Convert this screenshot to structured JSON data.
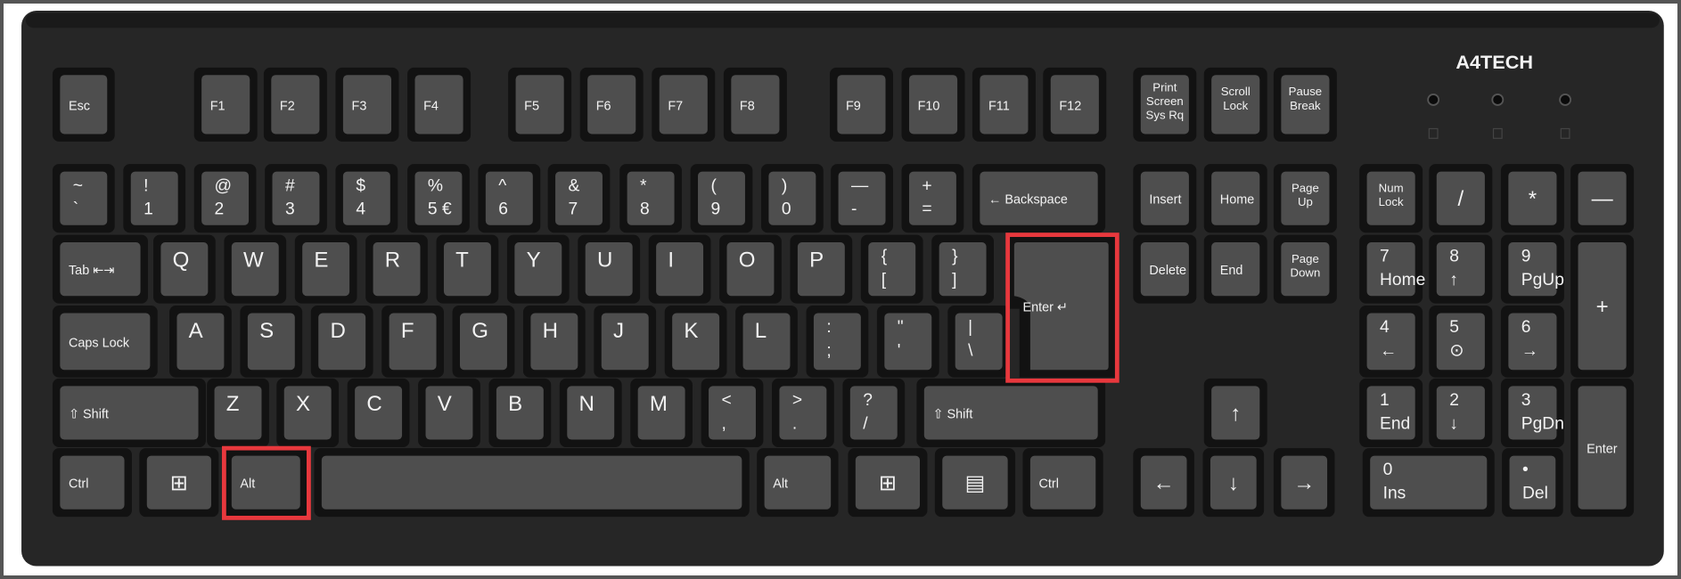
{
  "brand": {
    "logo": "A4TECH"
  },
  "colors": {
    "body": "#262626",
    "well": "#121212",
    "cap": "#4e4e4e",
    "legend": "#f2f2f2",
    "highlight": "#e8383d"
  },
  "indicators": [
    "num-lock-led",
    "caps-lock-led",
    "scroll-lock-led"
  ],
  "highlighted_keys": [
    "enter",
    "alt-left"
  ],
  "keys": [
    {
      "id": "esc",
      "lines": [
        "Esc"
      ]
    },
    {
      "id": "f1",
      "lines": [
        "F1"
      ]
    },
    {
      "id": "f2",
      "lines": [
        "F2"
      ]
    },
    {
      "id": "f3",
      "lines": [
        "F3"
      ]
    },
    {
      "id": "f4",
      "lines": [
        "F4"
      ]
    },
    {
      "id": "f5",
      "lines": [
        "F5"
      ]
    },
    {
      "id": "f6",
      "lines": [
        "F6"
      ]
    },
    {
      "id": "f7",
      "lines": [
        "F7"
      ]
    },
    {
      "id": "f8",
      "lines": [
        "F8"
      ]
    },
    {
      "id": "f9",
      "lines": [
        "F9"
      ]
    },
    {
      "id": "f10",
      "lines": [
        "F10"
      ]
    },
    {
      "id": "f11",
      "lines": [
        "F11"
      ]
    },
    {
      "id": "f12",
      "lines": [
        "F12"
      ]
    },
    {
      "id": "print-screen",
      "lines": [
        "Print",
        "Screen",
        "Sys Rq"
      ]
    },
    {
      "id": "scroll-lock",
      "lines": [
        "Scroll",
        "Lock"
      ]
    },
    {
      "id": "pause",
      "lines": [
        "Pause",
        "Break"
      ]
    },
    {
      "id": "tilde",
      "lines": [
        "~",
        "`"
      ]
    },
    {
      "id": "1",
      "lines": [
        "!",
        "1"
      ]
    },
    {
      "id": "2",
      "lines": [
        "@",
        "2"
      ]
    },
    {
      "id": "3",
      "lines": [
        "#",
        "3"
      ]
    },
    {
      "id": "4",
      "lines": [
        "$",
        "4"
      ]
    },
    {
      "id": "5",
      "lines": [
        "%",
        "5 €"
      ]
    },
    {
      "id": "6",
      "lines": [
        "^",
        "6"
      ]
    },
    {
      "id": "7",
      "lines": [
        "&",
        "7"
      ]
    },
    {
      "id": "8",
      "lines": [
        "*",
        "8"
      ]
    },
    {
      "id": "9",
      "lines": [
        "(",
        "9"
      ]
    },
    {
      "id": "0",
      "lines": [
        ")",
        "0"
      ]
    },
    {
      "id": "minus",
      "lines": [
        "—",
        "-"
      ]
    },
    {
      "id": "equals",
      "lines": [
        "+",
        "="
      ]
    },
    {
      "id": "backspace",
      "lines": [
        "← Backspace"
      ]
    },
    {
      "id": "insert",
      "lines": [
        "Insert"
      ]
    },
    {
      "id": "home",
      "lines": [
        "Home"
      ]
    },
    {
      "id": "page-up",
      "lines": [
        "Page",
        "Up"
      ]
    },
    {
      "id": "num-lock",
      "lines": [
        "Num",
        "Lock"
      ]
    },
    {
      "id": "num-divide",
      "lines": [
        "/"
      ]
    },
    {
      "id": "num-multiply",
      "lines": [
        "*"
      ]
    },
    {
      "id": "num-minus",
      "lines": [
        "—"
      ]
    },
    {
      "id": "tab",
      "lines": [
        "Tab ⇤⇥"
      ]
    },
    {
      "id": "q",
      "lines": [
        "Q"
      ]
    },
    {
      "id": "w",
      "lines": [
        "W"
      ]
    },
    {
      "id": "e",
      "lines": [
        "E"
      ]
    },
    {
      "id": "r",
      "lines": [
        "R"
      ]
    },
    {
      "id": "t",
      "lines": [
        "T"
      ]
    },
    {
      "id": "y",
      "lines": [
        "Y"
      ]
    },
    {
      "id": "u",
      "lines": [
        "U"
      ]
    },
    {
      "id": "i",
      "lines": [
        "I"
      ]
    },
    {
      "id": "o",
      "lines": [
        "O"
      ]
    },
    {
      "id": "p",
      "lines": [
        "P"
      ]
    },
    {
      "id": "bracket-left",
      "lines": [
        "{",
        "["
      ]
    },
    {
      "id": "bracket-right",
      "lines": [
        "}",
        "]"
      ]
    },
    {
      "id": "enter",
      "lines": [
        "Enter ↵"
      ]
    },
    {
      "id": "delete",
      "lines": [
        "Delete"
      ]
    },
    {
      "id": "end",
      "lines": [
        "End"
      ]
    },
    {
      "id": "page-down",
      "lines": [
        "Page",
        "Down"
      ]
    },
    {
      "id": "num-7",
      "lines": [
        "7",
        "Home"
      ]
    },
    {
      "id": "num-8",
      "lines": [
        "8",
        "↑"
      ]
    },
    {
      "id": "num-9",
      "lines": [
        "9",
        "PgUp"
      ]
    },
    {
      "id": "num-plus",
      "lines": [
        "+"
      ]
    },
    {
      "id": "caps-lock",
      "lines": [
        "Caps Lock"
      ]
    },
    {
      "id": "a",
      "lines": [
        "A"
      ]
    },
    {
      "id": "s",
      "lines": [
        "S"
      ]
    },
    {
      "id": "d",
      "lines": [
        "D"
      ]
    },
    {
      "id": "f",
      "lines": [
        "F"
      ]
    },
    {
      "id": "g",
      "lines": [
        "G"
      ]
    },
    {
      "id": "h",
      "lines": [
        "H"
      ]
    },
    {
      "id": "j",
      "lines": [
        "J"
      ]
    },
    {
      "id": "k",
      "lines": [
        "K"
      ]
    },
    {
      "id": "l",
      "lines": [
        "L"
      ]
    },
    {
      "id": "semicolon",
      "lines": [
        ":",
        ";"
      ]
    },
    {
      "id": "quote",
      "lines": [
        "\"",
        "'"
      ]
    },
    {
      "id": "backslash",
      "lines": [
        "|",
        "\\"
      ]
    },
    {
      "id": "num-4",
      "lines": [
        "4",
        "←"
      ]
    },
    {
      "id": "num-5",
      "lines": [
        "5",
        "⊙"
      ]
    },
    {
      "id": "num-6",
      "lines": [
        "6",
        "→"
      ]
    },
    {
      "id": "shift-left",
      "lines": [
        "⇧ Shift"
      ]
    },
    {
      "id": "z",
      "lines": [
        "Z"
      ]
    },
    {
      "id": "x",
      "lines": [
        "X"
      ]
    },
    {
      "id": "c",
      "lines": [
        "C"
      ]
    },
    {
      "id": "v",
      "lines": [
        "V"
      ]
    },
    {
      "id": "b",
      "lines": [
        "B"
      ]
    },
    {
      "id": "n",
      "lines": [
        "N"
      ]
    },
    {
      "id": "m",
      "lines": [
        "M"
      ]
    },
    {
      "id": "comma",
      "lines": [
        "<",
        ","
      ]
    },
    {
      "id": "period",
      "lines": [
        ">",
        "."
      ]
    },
    {
      "id": "slash",
      "lines": [
        "?",
        "/"
      ]
    },
    {
      "id": "shift-right",
      "lines": [
        "⇧ Shift"
      ]
    },
    {
      "id": "arrow-up",
      "lines": [
        "↑"
      ]
    },
    {
      "id": "num-1",
      "lines": [
        "1",
        "End"
      ]
    },
    {
      "id": "num-2",
      "lines": [
        "2",
        "↓"
      ]
    },
    {
      "id": "num-3",
      "lines": [
        "3",
        "PgDn"
      ]
    },
    {
      "id": "num-enter",
      "lines": [
        "Enter"
      ]
    },
    {
      "id": "ctrl-left",
      "lines": [
        "Ctrl"
      ]
    },
    {
      "id": "win-left",
      "lines": [
        "⊞"
      ]
    },
    {
      "id": "alt-left",
      "lines": [
        "Alt"
      ]
    },
    {
      "id": "space",
      "lines": [
        ""
      ]
    },
    {
      "id": "alt-right",
      "lines": [
        "Alt"
      ]
    },
    {
      "id": "win-right",
      "lines": [
        "⊞"
      ]
    },
    {
      "id": "menu",
      "lines": [
        "▤"
      ]
    },
    {
      "id": "ctrl-right",
      "lines": [
        "Ctrl"
      ]
    },
    {
      "id": "arrow-left",
      "lines": [
        "←"
      ]
    },
    {
      "id": "arrow-down",
      "lines": [
        "↓"
      ]
    },
    {
      "id": "arrow-right",
      "lines": [
        "→"
      ]
    },
    {
      "id": "num-0",
      "lines": [
        "0",
        "Ins"
      ]
    },
    {
      "id": "num-decimal",
      "lines": [
        "•",
        "Del"
      ]
    }
  ]
}
